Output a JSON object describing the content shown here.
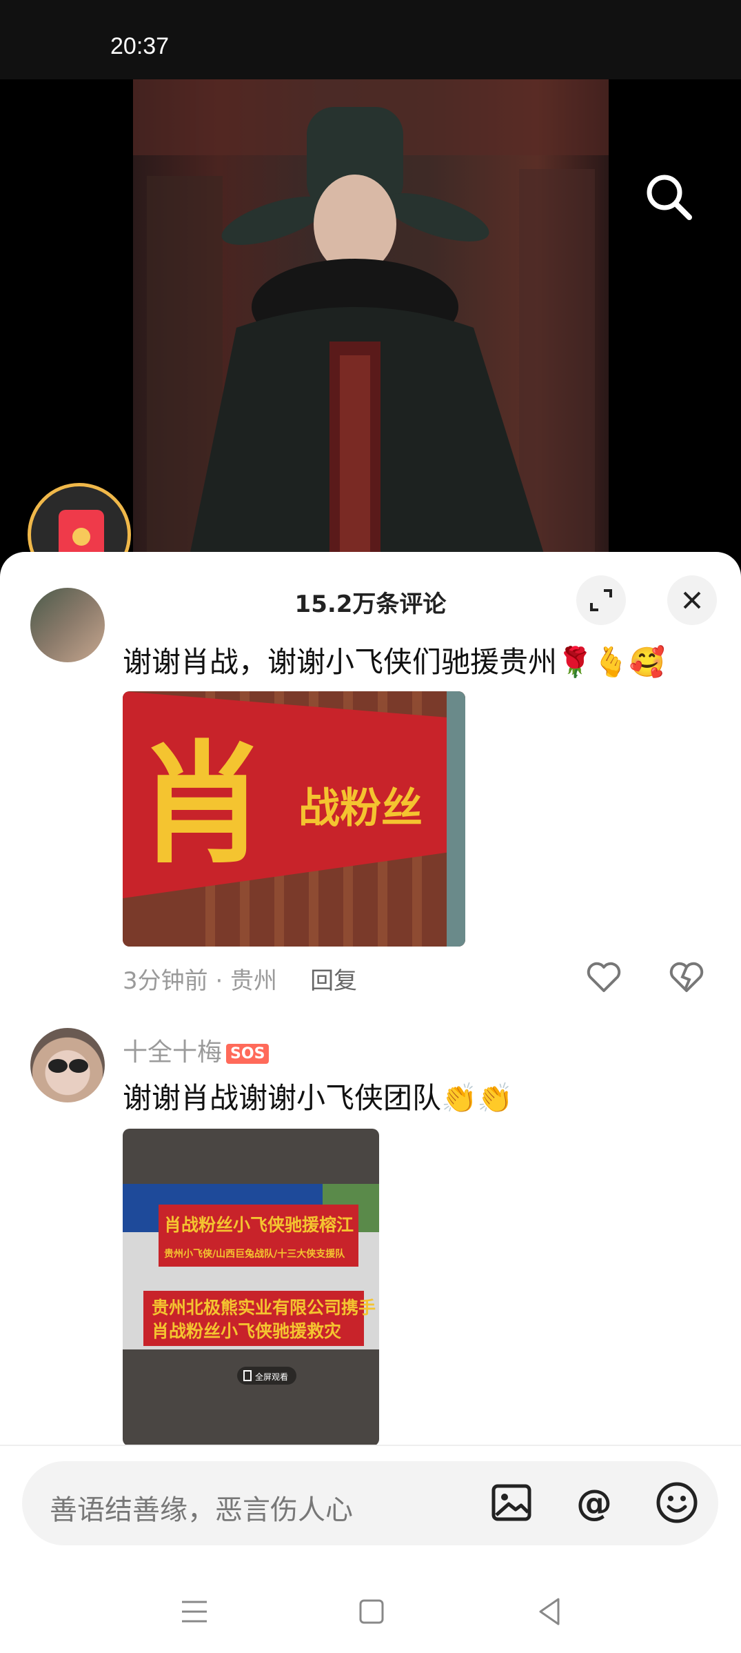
{
  "status_bar": {
    "time": "20:37"
  },
  "sheet": {
    "title": "15.2万条评论"
  },
  "comments": [
    {
      "username": "",
      "text": "谢谢肖战，谢谢小飞侠们驰援贵州🌹🫰🥰",
      "image_text": [
        "肖",
        "战粉丝"
      ],
      "time": "3分钟前 · 贵州",
      "reply_label": "回复"
    },
    {
      "username": "十全十梅",
      "badge": "SOS",
      "text": "谢谢肖战谢谢小飞侠团队👏👏",
      "image_text": [
        "肖战粉丝小飞侠驰援榕江",
        "贵州小飞侠/山西巨兔战队/十三大侠支援队",
        "贵州北极熊实业有限公司携手",
        "肖战粉丝小飞侠驰援救灾",
        "全屏观看"
      ]
    }
  ],
  "input": {
    "placeholder": "善语结善缘，恶言伤人心"
  },
  "colors": {
    "accent_red": "#ef3a4a",
    "gold": "#f0b84a",
    "banner_red": "#c8232a",
    "banner_text": "#f4c430"
  }
}
